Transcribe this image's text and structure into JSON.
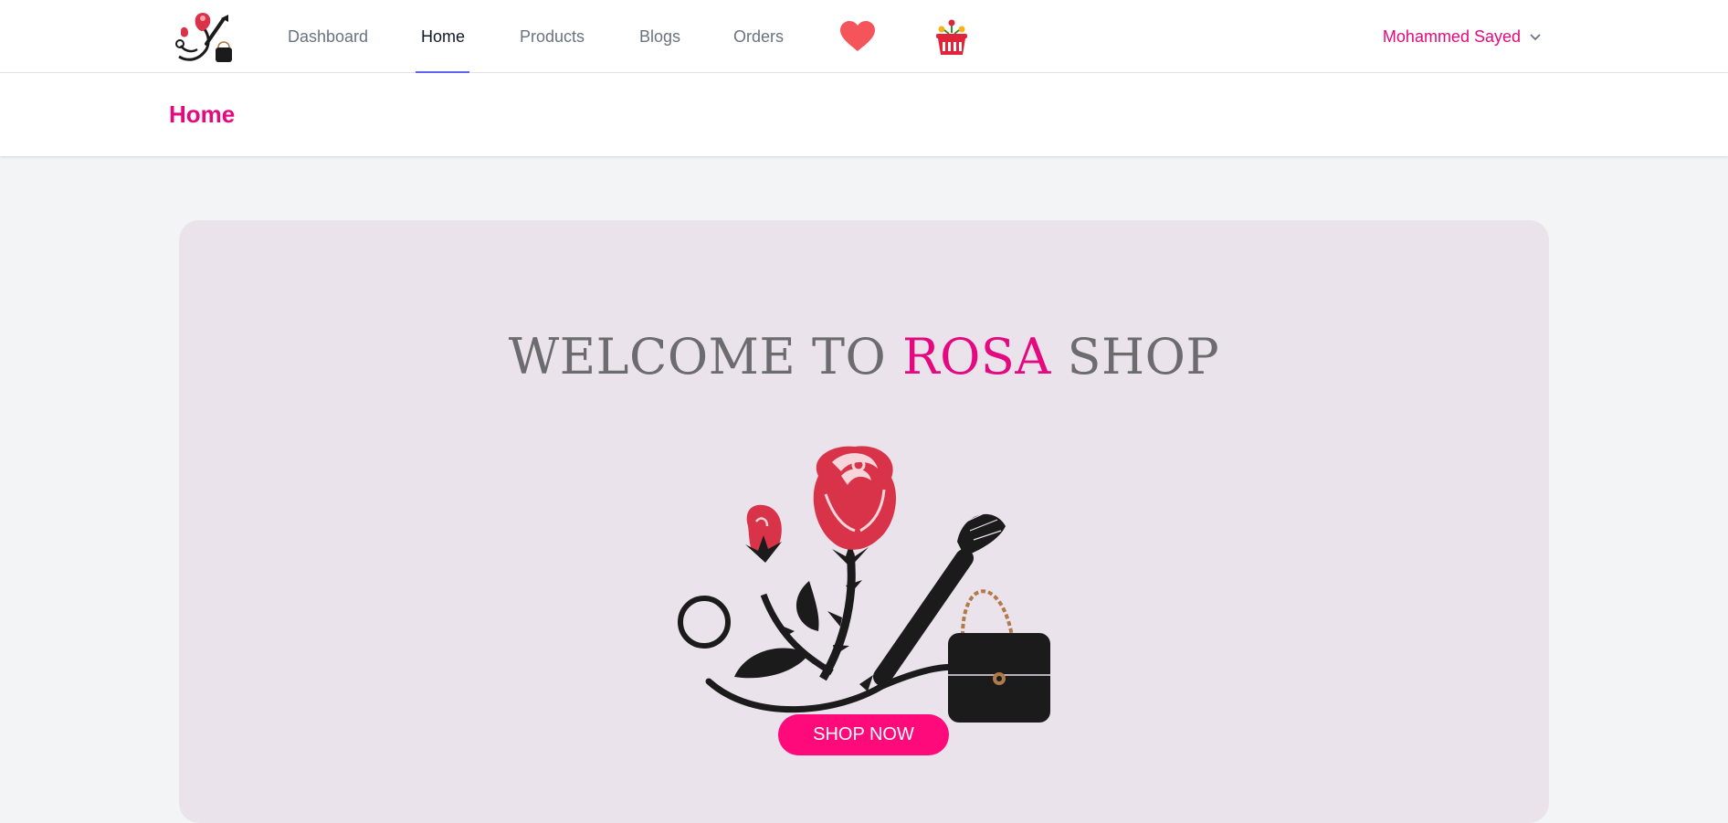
{
  "colors": {
    "accent": "#e5097f",
    "button": "#ff0a7a",
    "active_underline": "#6366f1",
    "hero_background": "#ebe3eb"
  },
  "navbar": {
    "logo_icon": "rosa-logo-icon",
    "links": [
      {
        "label": "Dashboard",
        "active": false
      },
      {
        "label": "Home",
        "active": true
      },
      {
        "label": "Products",
        "active": false
      },
      {
        "label": "Blogs",
        "active": false
      },
      {
        "label": "Orders",
        "active": false
      }
    ],
    "wishlist_icon": "heart-icon",
    "cart_icon": "basket-icon",
    "user_name": "Mohammed Sayed",
    "user_menu_icon": "chevron-down-icon"
  },
  "page_header": {
    "title": "Home"
  },
  "hero": {
    "title_part1": "WELCOME TO ",
    "title_accent": "ROSA",
    "title_part2": " SHOP",
    "illustration_icon": "rose-brush-handbag-illustration",
    "cta_label": "SHOP NOW"
  }
}
